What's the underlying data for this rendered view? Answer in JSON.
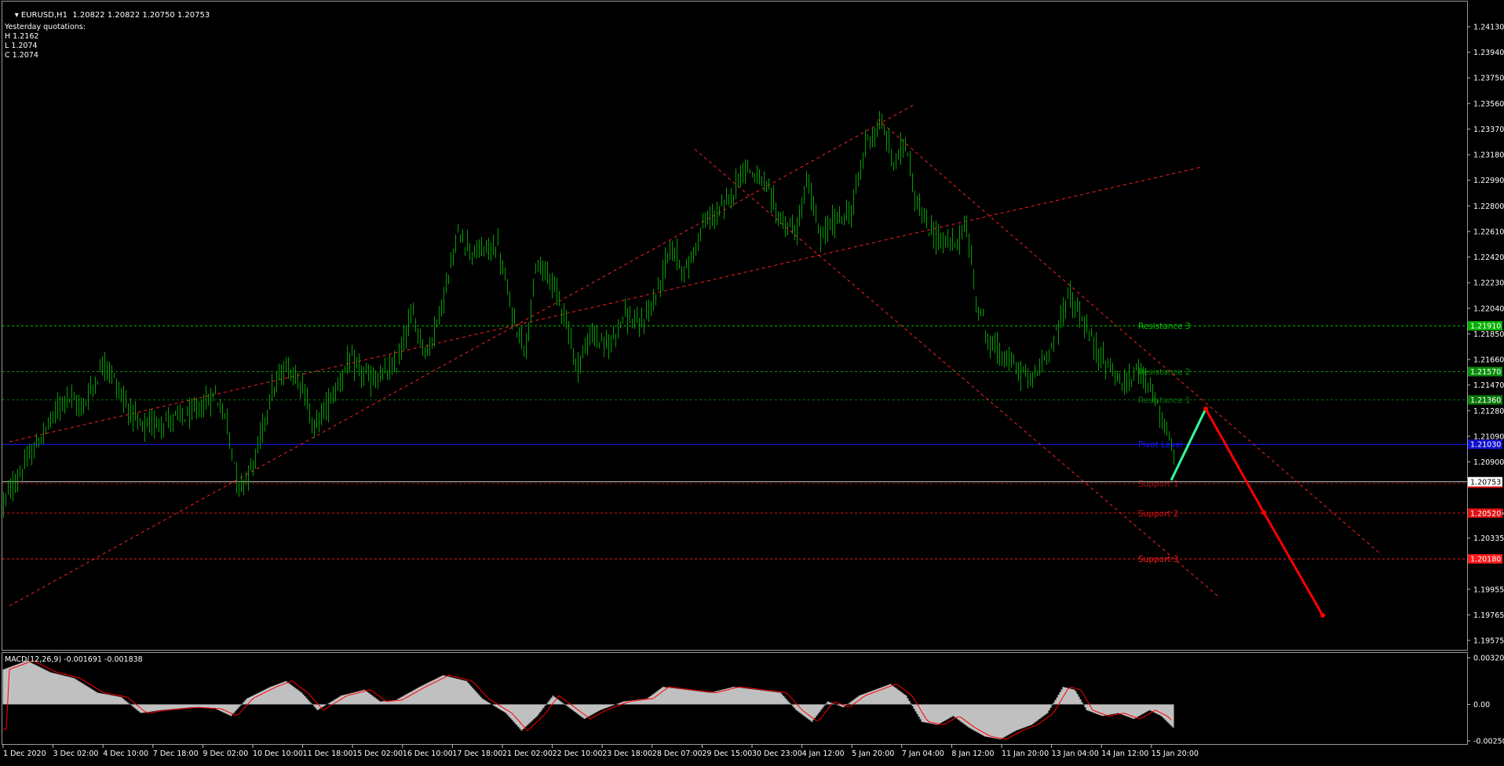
{
  "header": {
    "symbol": "EURUSD,H1",
    "ohlc": "1.20822 1.20822 1.20750 1.20753",
    "dropdown_icon": "triangle-down-icon"
  },
  "yesterday": {
    "title": "Yesterday quotations:",
    "high": "H 1.2162",
    "low": "L 1.2074",
    "close": "C 1.2074"
  },
  "price_axis": {
    "ticks": [
      "1.24130",
      "1.23940",
      "1.23750",
      "1.23560",
      "1.23370",
      "1.23180",
      "1.22990",
      "1.22800",
      "1.22610",
      "1.22420",
      "1.22230",
      "1.22040",
      "1.21850",
      "1.21660",
      "1.21470",
      "1.21280",
      "1.21090",
      "1.20900",
      "1.20525",
      "1.20335",
      "1.19955",
      "1.19765",
      "1.19575"
    ],
    "range": [
      1.19575,
      1.2413
    ]
  },
  "time_axis": {
    "labels": [
      "1 Dec 2020",
      "3 Dec 02:00",
      "4 Dec 10:00",
      "7 Dec 18:00",
      "9 Dec 02:00",
      "10 Dec 10:00",
      "11 Dec 18:00",
      "15 Dec 02:00",
      "16 Dec 10:00",
      "17 Dec 18:00",
      "21 Dec 02:00",
      "22 Dec 10:00",
      "23 Dec 18:00",
      "28 Dec 07:00",
      "29 Dec 15:00",
      "30 Dec 23:00",
      "4 Jan 12:00",
      "5 Jan 20:00",
      "7 Jan 04:00",
      "8 Jan 12:00",
      "11 Jan 20:00",
      "13 Jan 04:00",
      "14 Jan 12:00",
      "15 Jan 20:00"
    ]
  },
  "levels": [
    {
      "label": "Resistance 3",
      "price": 1.2191,
      "tag": "1.21910",
      "color": "#00cc00",
      "tag_bg": "#00b000"
    },
    {
      "label": "Resistance 2",
      "price": 1.2157,
      "tag": "1.21570",
      "color": "#0a8f0a",
      "tag_bg": "#0a8f0a"
    },
    {
      "label": "Resistance 1",
      "price": 1.2136,
      "tag": "1.21360",
      "color": "#0a6e0a",
      "tag_bg": "#0a7a0a"
    },
    {
      "label": "Pivot Level",
      "price": 1.2103,
      "tag": "1.21030",
      "color": "#1a1aff",
      "tag_bg": "#1010cc"
    },
    {
      "label": "Support 1",
      "price": 1.2074,
      "tag": "1.20740",
      "color": "#a01010",
      "tag_bg": "#c01010"
    },
    {
      "label": "Support 2",
      "price": 1.2052,
      "tag": "1.20520",
      "color": "#e01010",
      "tag_bg": "#e01010"
    },
    {
      "label": "Support 3",
      "price": 1.2018,
      "tag": "1.20180",
      "color": "#ff1a1a",
      "tag_bg": "#ff1a1a"
    }
  ],
  "current_price": {
    "price": 1.20753,
    "tag": "1.20753",
    "color": "#ffffff"
  },
  "macd": {
    "label": "MACD(12,26,9) -0.001691 -0.001838",
    "ticks": [
      "0.003204",
      "0.00",
      "-0.002506"
    ],
    "range": [
      -0.002506,
      0.003204
    ]
  },
  "colors": {
    "background": "#000000",
    "bull_candle": "#00a000",
    "forecast_up": "#33ff99",
    "forecast_down": "#ff0000",
    "trendline": "#ff2020",
    "macd_hist": "#c0c0c0",
    "macd_signal": "#ff0000"
  }
}
